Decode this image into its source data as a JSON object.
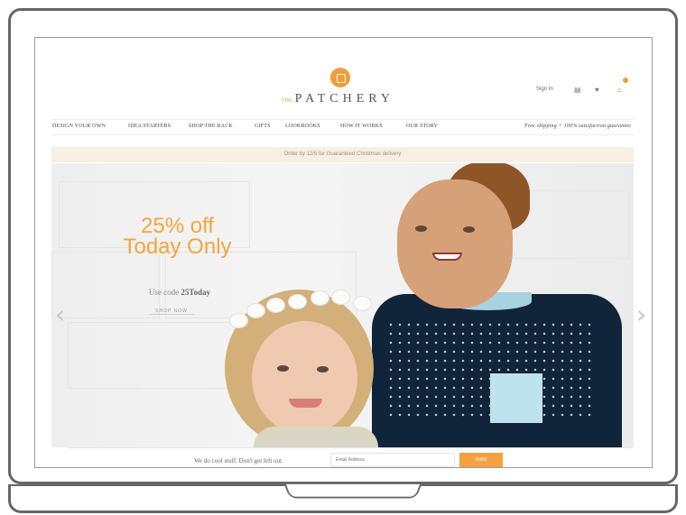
{
  "brand": {
    "prefix": "THE",
    "name": "PATCHERY"
  },
  "header": {
    "signin": "Sign In",
    "icons": [
      "account-icon",
      "favorites-icon",
      "cart-icon"
    ]
  },
  "nav": {
    "items": [
      "DESIGN YOUR OWN",
      "IDEA STARTERS",
      "SHOP THE RACK",
      "GIFTS",
      "LOOKBOOKS",
      "HOW IT WORKS",
      "OUR STORY"
    ],
    "shipping_note": "Free shipping + 100% satisfaction guarantee"
  },
  "announcement": "Order by 12/5 for Guaranteed Christmas delivery",
  "hero": {
    "promo_line1": "25% off",
    "promo_line2": "Today Only",
    "code_prefix": "Use code",
    "code": "25Today",
    "cta": "SHOP NOW",
    "left_arrow": "‹",
    "right_arrow": "›"
  },
  "newsletter": {
    "text": "We do cool stuff. Don't get left out.",
    "email_placeholder": "Email Address",
    "submit": "SIGN"
  },
  "colors": {
    "accent": "#f39c3c",
    "text": "#555555"
  }
}
